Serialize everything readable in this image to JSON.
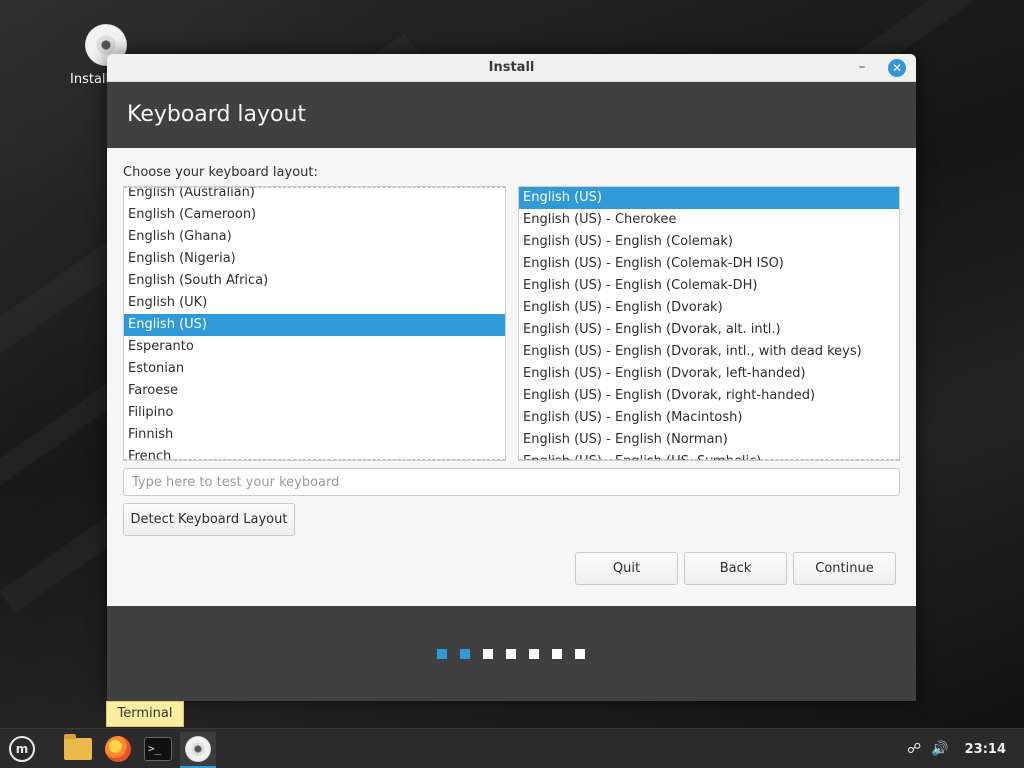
{
  "desktop": {
    "icon_label": "Install"
  },
  "window": {
    "title": "Install",
    "minimize_glyph": "–",
    "close_glyph": "✕",
    "header_title": "Keyboard layout",
    "choose_label": "Choose your keyboard layout:",
    "layouts": [
      "English (Australian)",
      "English (Cameroon)",
      "English (Ghana)",
      "English (Nigeria)",
      "English (South Africa)",
      "English (UK)",
      "English (US)",
      "Esperanto",
      "Estonian",
      "Faroese",
      "Filipino",
      "Finnish",
      "French"
    ],
    "selected_layout": "English (US)",
    "variants": [
      "English (US)",
      "English (US) - Cherokee",
      "English (US) - English (Colemak)",
      "English (US) - English (Colemak-DH ISO)",
      "English (US) - English (Colemak-DH)",
      "English (US) - English (Dvorak)",
      "English (US) - English (Dvorak, alt. intl.)",
      "English (US) - English (Dvorak, intl., with dead keys)",
      "English (US) - English (Dvorak, left-handed)",
      "English (US) - English (Dvorak, right-handed)",
      "English (US) - English (Macintosh)",
      "English (US) - English (Norman)",
      "English (US) - English (US, Symbolic)"
    ],
    "selected_variant": "English (US)",
    "test_input": {
      "value": "",
      "placeholder": "Type here to test your keyboard"
    },
    "detect_button": "Detect Keyboard Layout",
    "quit_button": "Quit",
    "back_button": "Back",
    "continue_button": "Continue",
    "progress": {
      "total_steps": 7,
      "completed_steps": 2
    }
  },
  "tooltip": "Terminal",
  "taskbar": {
    "apps": [
      {
        "name": "menu-icon",
        "glyph": "m"
      },
      {
        "name": "files-icon"
      },
      {
        "name": "firefox-icon"
      },
      {
        "name": "terminal-icon",
        "glyph": ">_"
      },
      {
        "name": "install-disc-icon"
      }
    ],
    "tray": {
      "network_glyph": "☍",
      "volume_glyph": "🔊",
      "clock": "23:14"
    }
  },
  "colors": {
    "accent": "#2e9ad8",
    "header_bg": "#404040",
    "tooltip_bg": "#fbeea0"
  }
}
